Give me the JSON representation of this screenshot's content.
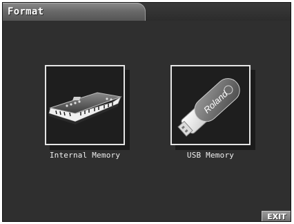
{
  "header": {
    "title": "Format"
  },
  "targets": [
    {
      "label": "Internal Memory",
      "icon": "keyboard-synth-icon"
    },
    {
      "label": "USB Memory",
      "icon": "usb-flash-drive-icon",
      "brand_text": "Roland"
    }
  ],
  "footer": {
    "exit_label": "EXIT"
  }
}
